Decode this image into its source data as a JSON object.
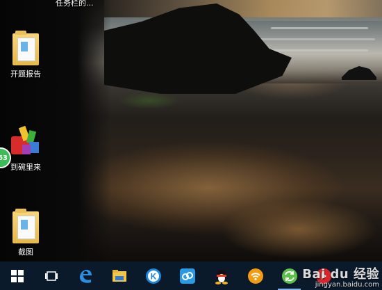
{
  "desktop": {
    "top_text": "任务栏的...",
    "icons": [
      {
        "label": "开题报告",
        "icon": "folder-icon"
      },
      {
        "label": "到碗里来",
        "icon": "installer-icon"
      },
      {
        "label": "截图",
        "icon": "folder-icon"
      }
    ],
    "badge": {
      "text": "63",
      "color": "#3dbb55"
    }
  },
  "taskbar": {
    "background": "#0b1a2b",
    "buttons": [
      {
        "name": "start-button",
        "icon": "windows-logo-icon"
      },
      {
        "name": "task-view-button",
        "icon": "task-view-icon"
      },
      {
        "name": "edge-button",
        "icon": "edge-icon"
      },
      {
        "name": "file-explorer-button",
        "icon": "folder-icon"
      },
      {
        "name": "kugou-button",
        "icon": "k-circle-icon"
      },
      {
        "name": "baidu-netdisk-button",
        "icon": "cloud-icon"
      },
      {
        "name": "qq-button",
        "icon": "penguin-icon"
      },
      {
        "name": "wifi-app-button",
        "icon": "wifi-icon"
      },
      {
        "name": "sync-app-button",
        "icon": "sync-icon"
      },
      {
        "name": "red-app-button",
        "icon": "red-circle-icon"
      }
    ]
  },
  "watermark": {
    "logo": "Bai du 经验",
    "url": "jingyan.baidu.com"
  }
}
